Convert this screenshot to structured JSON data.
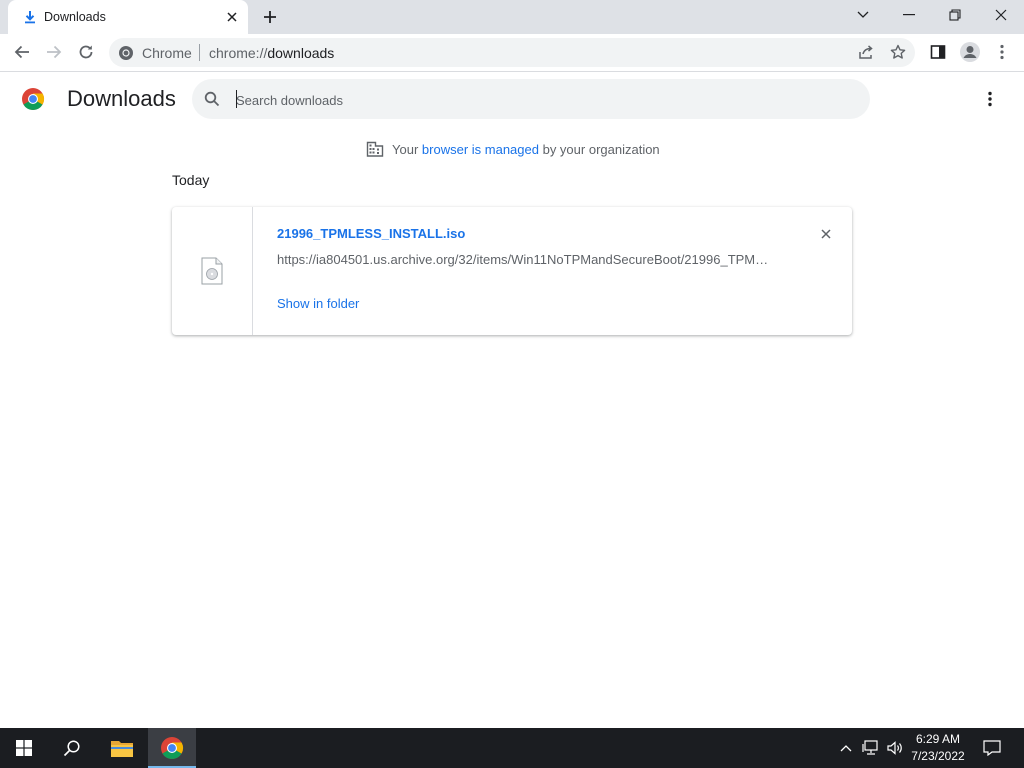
{
  "tab": {
    "title": "Downloads",
    "icon": "download-icon"
  },
  "window_controls": [
    "tab-search-icon",
    "minimize-icon",
    "restore-icon",
    "close-icon"
  ],
  "omnibox": {
    "site_label": "Chrome",
    "url_scheme": "chrome://",
    "url_host": "downloads"
  },
  "page": {
    "title": "Downloads",
    "search_placeholder": "Search downloads",
    "managed_prefix": "Your",
    "managed_link": "browser is managed",
    "managed_suffix": "by your organization",
    "date_header": "Today"
  },
  "download": {
    "file_name": "21996_TPMLESS_INSTALL.iso",
    "url": "https://ia804501.us.archive.org/32/items/Win11NoTPMandSecureBoot/21996_TPM…",
    "action": "Show in folder"
  },
  "taskbar": {
    "time": "6:29 AM",
    "date": "7/23/2022",
    "apps": [
      "start",
      "search",
      "file-explorer",
      "chrome"
    ]
  },
  "colors": {
    "accent": "#1a73e8",
    "tabstrip": "#dee1e6",
    "taskbar": "#1b1d21"
  }
}
